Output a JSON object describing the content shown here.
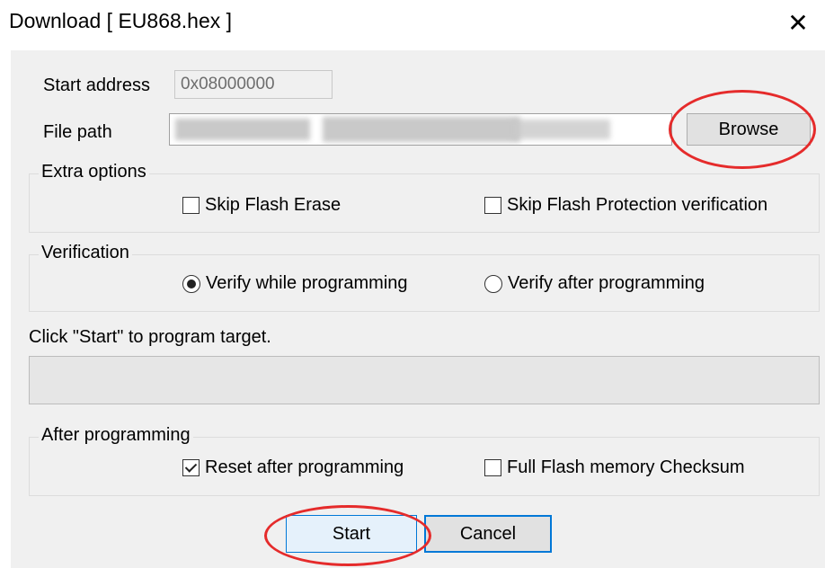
{
  "window": {
    "title": "Download [ EU868.hex ]",
    "close_glyph": "✕"
  },
  "fields": {
    "start_address_label": "Start address",
    "start_address_value": "0x08000000",
    "file_path_label": "File path",
    "browse_label": "Browse"
  },
  "extra_options": {
    "legend": "Extra options",
    "skip_erase": {
      "label": "Skip Flash Erase",
      "checked": false
    },
    "skip_protection": {
      "label": "Skip Flash Protection verification",
      "checked": false
    }
  },
  "verification": {
    "legend": "Verification",
    "while_programming": {
      "label": "Verify while programming",
      "checked": true
    },
    "after_programming": {
      "label": "Verify after programming",
      "checked": false
    }
  },
  "status": {
    "message": "Click \"Start\" to program target.",
    "progress_fraction": 0
  },
  "after_programming": {
    "legend": "After programming",
    "reset": {
      "label": "Reset after programming",
      "checked": true
    },
    "checksum": {
      "label": "Full Flash memory Checksum",
      "checked": false
    }
  },
  "buttons": {
    "start_label": "Start",
    "cancel_label": "Cancel"
  },
  "annotations": {
    "highlight_color": "#e52b2b"
  }
}
